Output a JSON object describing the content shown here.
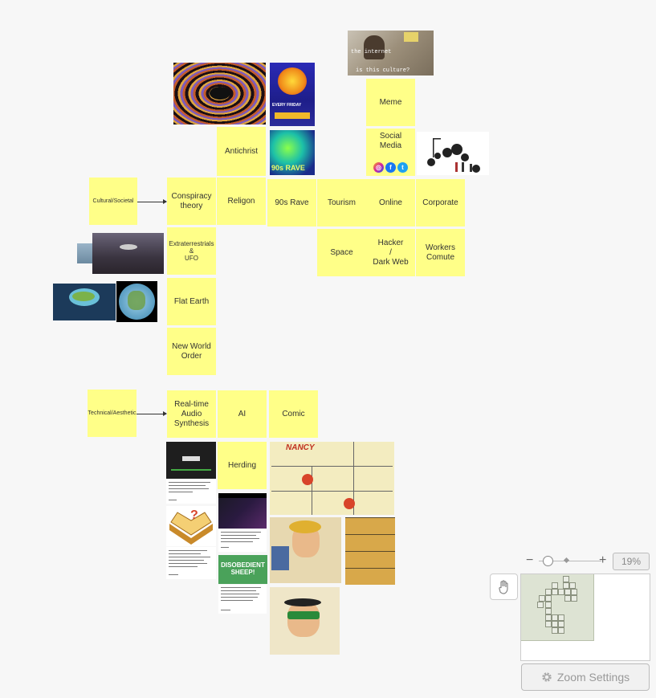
{
  "notes": {
    "meme": "Meme",
    "antichrist": "Antichrist",
    "social_media": "Social Media",
    "cultural_societal": "Cultural/Societal",
    "conspiracy_theory": "Conspiracy\ntheory",
    "religon": "Religon",
    "nineties_rave": "90s Rave",
    "tourism": "Tourism",
    "online": "Online",
    "corporate": "Corporate",
    "extraterrestrials_ufo": "Extraterrestrials\n&\nUFO",
    "space": "Space",
    "hacker_dark_web": "Hacker\n/\nDark Web",
    "workers_comute": "Workers\nComute",
    "flat_earth": "Flat Earth",
    "new_world_order": "New World\nOrder",
    "technical_aesthetic": "Technical/Aesthetic",
    "realtime_audio_synthesis": "Real-time\nAudio\nSynthesis",
    "ai": "AI",
    "comic": "Comic",
    "herding": "Herding"
  },
  "images": {
    "meme_caption_top": "the internet",
    "meme_caption_bottom": "is this culture?",
    "rave_poster_text": "EVERY FRIDAY",
    "rave_90s_text": "90s RAVE",
    "sheep_text": "DISOBEDIENT SHEEP!",
    "comic_title": "NANCY"
  },
  "social_icons": [
    "instagram-icon",
    "facebook-icon",
    "twitter-icon"
  ],
  "zoom": {
    "percent": "19%",
    "minus": "−",
    "plus": "+",
    "settings_label": "Zoom Settings"
  },
  "colors": {
    "sticky_note": "#ffff88",
    "canvas_bg": "#f7f7f7"
  }
}
